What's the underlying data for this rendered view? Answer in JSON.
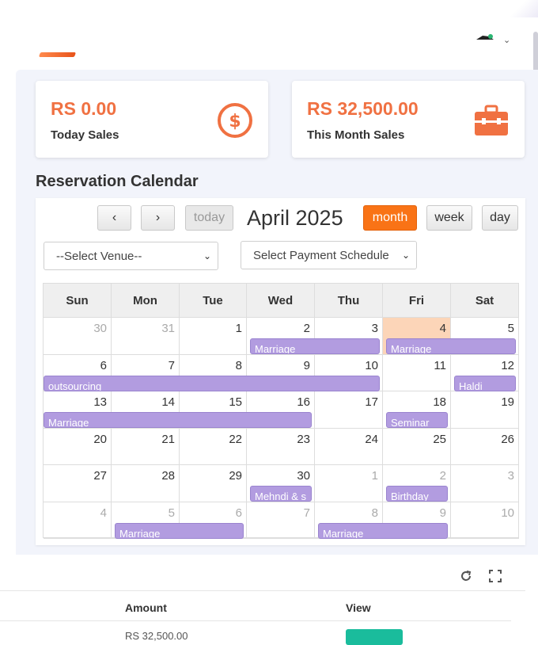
{
  "header": {
    "user_menu_caret": "⌄"
  },
  "cards": [
    {
      "amount": "RS 0.00",
      "label": "Today Sales",
      "icon": "dollar-circle-icon"
    },
    {
      "amount": "RS 32,500.00",
      "label": "This Month Sales",
      "icon": "briefcase-icon"
    }
  ],
  "calendar": {
    "section_title": "Reservation Calendar",
    "prev_label": "‹",
    "next_label": "›",
    "today_label": "today",
    "title": "April 2025",
    "month_label": "month",
    "week_label": "week",
    "day_label": "day",
    "venue_select": "--Select Venue--",
    "payment_select": "Select Payment Schedule",
    "days_of_week": [
      "Sun",
      "Mon",
      "Tue",
      "Wed",
      "Thu",
      "Fri",
      "Sat"
    ],
    "weeks": [
      [
        {
          "d": "30",
          "o": true
        },
        {
          "d": "31",
          "o": true
        },
        {
          "d": "1"
        },
        {
          "d": "2"
        },
        {
          "d": "3"
        },
        {
          "d": "4",
          "today": true
        },
        {
          "d": "5"
        }
      ],
      [
        {
          "d": "6"
        },
        {
          "d": "7"
        },
        {
          "d": "8"
        },
        {
          "d": "9"
        },
        {
          "d": "10"
        },
        {
          "d": "11"
        },
        {
          "d": "12"
        }
      ],
      [
        {
          "d": "13"
        },
        {
          "d": "14"
        },
        {
          "d": "15"
        },
        {
          "d": "16"
        },
        {
          "d": "17"
        },
        {
          "d": "18"
        },
        {
          "d": "19"
        }
      ],
      [
        {
          "d": "20"
        },
        {
          "d": "21"
        },
        {
          "d": "22"
        },
        {
          "d": "23"
        },
        {
          "d": "24"
        },
        {
          "d": "25"
        },
        {
          "d": "26"
        }
      ],
      [
        {
          "d": "27"
        },
        {
          "d": "28"
        },
        {
          "d": "29"
        },
        {
          "d": "30"
        },
        {
          "d": "1",
          "o": true
        },
        {
          "d": "2",
          "o": true
        },
        {
          "d": "3",
          "o": true
        }
      ],
      [
        {
          "d": "4",
          "o": true
        },
        {
          "d": "5",
          "o": true
        },
        {
          "d": "6",
          "o": true
        },
        {
          "d": "7",
          "o": true
        },
        {
          "d": "8",
          "o": true
        },
        {
          "d": "9",
          "o": true
        },
        {
          "d": "10",
          "o": true
        }
      ]
    ],
    "events": [
      {
        "title": "Marriage",
        "week": 0,
        "start": 3,
        "span": 2
      },
      {
        "title": "Marriage",
        "week": 0,
        "start": 5,
        "span": 2
      },
      {
        "title": "outsourcing",
        "week": 1,
        "start": 0,
        "span": 5
      },
      {
        "title": "Haldi",
        "week": 1,
        "start": 6,
        "span": 1
      },
      {
        "title": "Marriage",
        "week": 2,
        "start": 0,
        "span": 4
      },
      {
        "title": "Seminar",
        "week": 2,
        "start": 5,
        "span": 1
      },
      {
        "title": "Mehndi & s",
        "week": 4,
        "start": 3,
        "span": 1
      },
      {
        "title": "Birthday",
        "week": 4,
        "start": 5,
        "span": 1
      },
      {
        "title": "Marriage",
        "week": 5,
        "start": 1,
        "span": 2
      },
      {
        "title": "Marriage",
        "week": 5,
        "start": 4,
        "span": 2
      }
    ]
  },
  "table": {
    "columns": [
      "Amount",
      "View"
    ],
    "rows": [
      {
        "amount": "RS 32,500.00"
      }
    ]
  }
}
